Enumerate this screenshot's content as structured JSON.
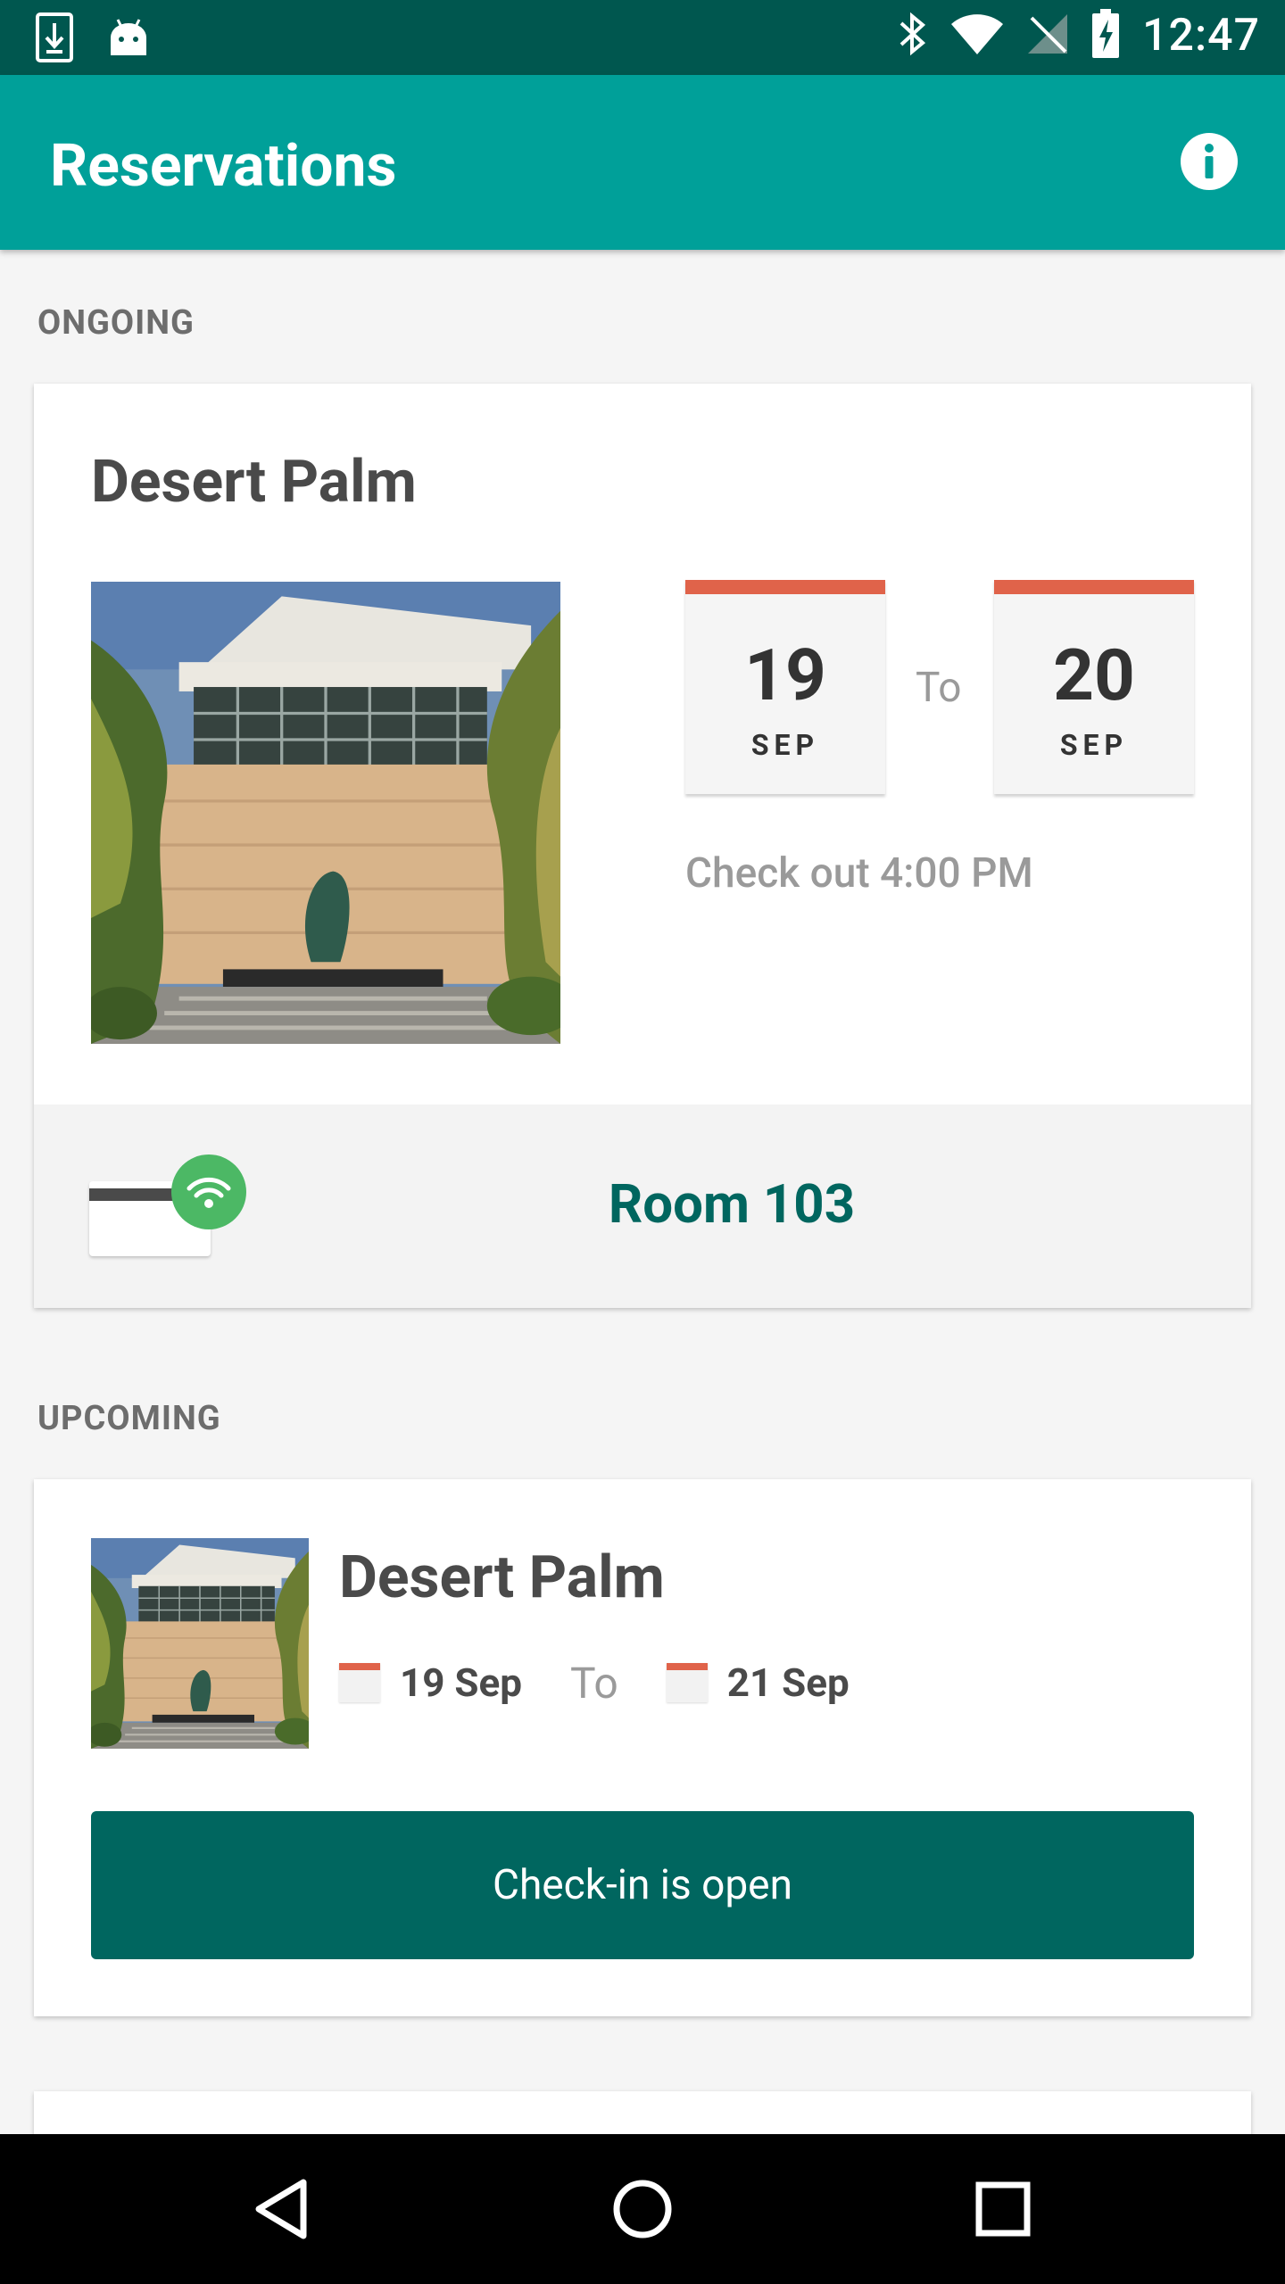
{
  "status_bar": {
    "time": "12:47",
    "left_icons": [
      "download-icon",
      "android-icon"
    ],
    "right_icons": [
      "bluetooth-icon",
      "wifi-icon",
      "no-signal-icon",
      "battery-icon"
    ]
  },
  "app_bar": {
    "title": "Reservations",
    "info_icon": "info-icon"
  },
  "colors": {
    "primary": "#00a099",
    "primary_dark": "#00574f",
    "accent_dark": "#00665f",
    "calendar_red": "#e0634a",
    "wifi_green": "#4cb865"
  },
  "ongoing": {
    "section_label": "ONGOING",
    "hotel_name": "Desert Palm",
    "check_in": {
      "day": "19",
      "month": "SEP"
    },
    "to_label": "To",
    "check_out": {
      "day": "20",
      "month": "SEP"
    },
    "checkout_time": "Check out 4:00 PM",
    "room": "Room 103"
  },
  "upcoming": {
    "section_label": "UPCOMING",
    "hotel_name": "Desert Palm",
    "from_date": "19 Sep",
    "to_label": "To",
    "to_date": "21 Sep",
    "checkin_button": "Check-in is open"
  },
  "nav_bar": {
    "buttons": [
      "back-icon",
      "home-icon",
      "recents-icon"
    ]
  }
}
